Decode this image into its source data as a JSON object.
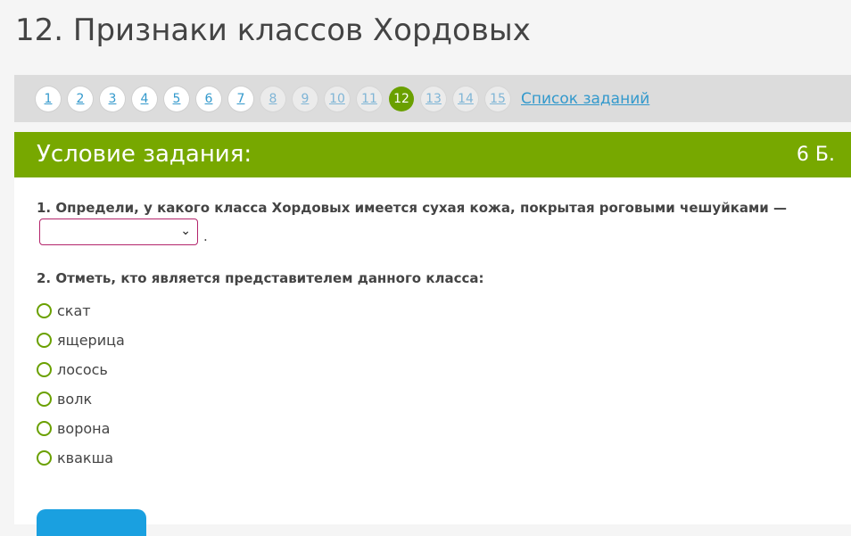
{
  "page": {
    "title": "12. Признаки классов Хордовых"
  },
  "pager": {
    "items": [
      {
        "label": "1",
        "state": "normal"
      },
      {
        "label": "2",
        "state": "normal"
      },
      {
        "label": "3",
        "state": "normal"
      },
      {
        "label": "4",
        "state": "normal"
      },
      {
        "label": "5",
        "state": "normal"
      },
      {
        "label": "6",
        "state": "normal"
      },
      {
        "label": "7",
        "state": "normal"
      },
      {
        "label": "8",
        "state": "faded"
      },
      {
        "label": "9",
        "state": "faded"
      },
      {
        "label": "10",
        "state": "faded"
      },
      {
        "label": "11",
        "state": "faded"
      },
      {
        "label": "12",
        "state": "active"
      },
      {
        "label": "13",
        "state": "faded"
      },
      {
        "label": "14",
        "state": "faded"
      },
      {
        "label": "15",
        "state": "faded"
      }
    ],
    "list_link": "Список заданий"
  },
  "task": {
    "header_title": "Условие задания:",
    "score": "6 Б.",
    "question1": "1. Определи, у какого класса Хордовых имеется сухая кожа, покрытая роговыми чешуйками —",
    "select_value": "",
    "select_suffix": ".",
    "question2": "2. Отметь, кто является представителем данного класса:",
    "options": [
      "скат",
      "ящерица",
      "лосось",
      "волк",
      "ворона",
      "квакша"
    ]
  },
  "colors": {
    "accent_green": "#77a800",
    "active_page": "#6aa000",
    "link_blue": "#3399cc",
    "select_border": "#b3246b",
    "button_blue": "#1aa0e0"
  }
}
